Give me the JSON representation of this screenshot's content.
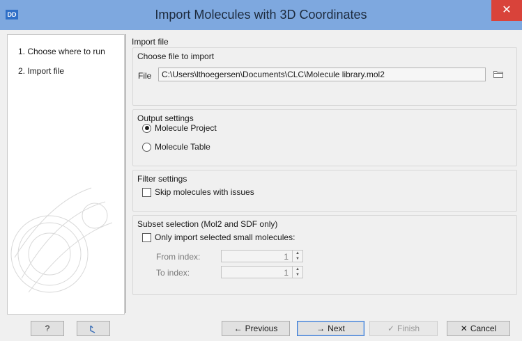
{
  "window": {
    "icon_text": "DD",
    "title": "Import Molecules with 3D Coordinates",
    "close_glyph": "✕"
  },
  "sidebar": {
    "steps": [
      {
        "label": "1.  Choose where to run"
      },
      {
        "label": "2.  Import file"
      }
    ]
  },
  "content": {
    "section_title": "Import file",
    "choose_file": {
      "title": "Choose file to import",
      "file_label": "File",
      "file_value": "C:\\Users\\lthoegersen\\Documents\\CLC\\Molecule library.mol2"
    },
    "output": {
      "title": "Output settings",
      "options": [
        {
          "label": "Molecule Project",
          "selected": true
        },
        {
          "label": "Molecule Table",
          "selected": false
        }
      ]
    },
    "filter": {
      "title": "Filter settings",
      "skip_label": "Skip molecules with issues"
    },
    "subset": {
      "title": "Subset selection (Mol2 and SDF only)",
      "only_label": "Only import selected small molecules:",
      "from_label": "From index:",
      "from_value": "1",
      "to_label": "To index:",
      "to_value": "1"
    }
  },
  "footer": {
    "help_label": "?",
    "reset_icon": "reset-icon",
    "previous_label": "Previous",
    "next_label": "Next",
    "finish_label": "Finish",
    "cancel_label": "Cancel"
  }
}
